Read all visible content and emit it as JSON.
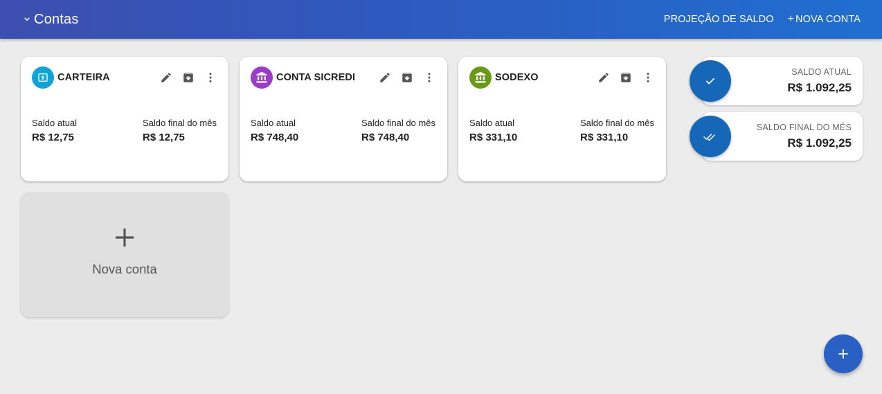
{
  "header": {
    "title": "Contas",
    "projection_label": "PROJEÇÃO DE SALDO",
    "new_account_label": "NOVA CONTA",
    "gradient": [
      "#3d4fb0",
      "#1f6fd0"
    ]
  },
  "accounts": [
    {
      "name": "CARTEIRA",
      "icon": "wallet-icon",
      "color": "#11a3d6",
      "current_label": "Saldo atual",
      "current_value": "R$ 12,75",
      "final_label": "Saldo final do mês",
      "final_value": "R$ 12,75"
    },
    {
      "name": "CONTA SICREDI",
      "icon": "bank-icon",
      "color": "#9c3ac9",
      "current_label": "Saldo atual",
      "current_value": "R$ 748,40",
      "final_label": "Saldo final do mês",
      "final_value": "R$ 748,40"
    },
    {
      "name": "SODEXO",
      "icon": "bank-icon",
      "color": "#6b9a16",
      "current_label": "Saldo atual",
      "current_value": "R$ 331,10",
      "final_label": "Saldo final do mês",
      "final_value": "R$ 331,10"
    }
  ],
  "new_account_card": {
    "label": "Nova conta"
  },
  "summary": {
    "current": {
      "label": "SALDO ATUAL",
      "value": "R$ 1.092,25",
      "icon": "check-icon"
    },
    "final": {
      "label": "SALDO FINAL DO MÊS",
      "value": "R$ 1.092,25",
      "icon": "double-check-icon"
    },
    "color": "#1767b8"
  },
  "fab": {
    "icon": "plus-icon",
    "color": "#2a5fc4"
  }
}
